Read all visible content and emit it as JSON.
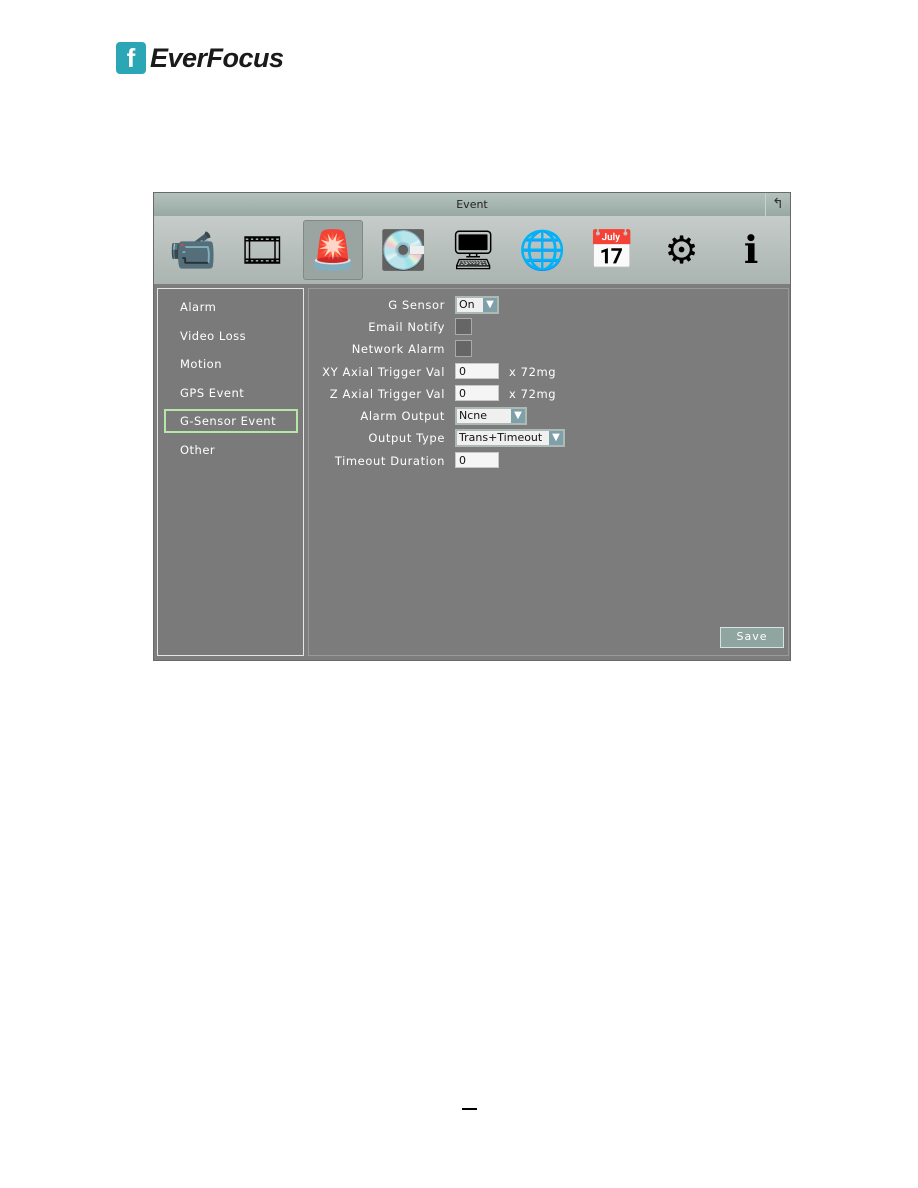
{
  "brand": {
    "logo_text": "EverFocus"
  },
  "window": {
    "title": "Event",
    "back_icon": "undo-arrow-icon"
  },
  "toolbar": {
    "icons": [
      "camera-icon",
      "film-reel-icon",
      "alarm-siren-icon",
      "hard-disk-icon",
      "monitor-icon",
      "network-globe-icon",
      "clock-calendar-icon",
      "gear-icon",
      "info-icon"
    ],
    "selected": "alarm-siren-icon"
  },
  "sidebar": {
    "items": [
      {
        "label": "Alarm"
      },
      {
        "label": "Video Loss"
      },
      {
        "label": "Motion"
      },
      {
        "label": "GPS Event"
      },
      {
        "label": "G-Sensor Event"
      },
      {
        "label": "Other"
      }
    ],
    "selected": "G-Sensor Event"
  },
  "form": {
    "g_sensor": {
      "label": "G Sensor",
      "value": "On"
    },
    "email_notify": {
      "label": "Email Notify",
      "checked": false
    },
    "network_alarm": {
      "label": "Network Alarm",
      "checked": false
    },
    "xy_trigger": {
      "label": "XY Axial Trigger Val",
      "value": "0",
      "unit": "x 72mg"
    },
    "z_trigger": {
      "label": "Z Axial Trigger Val",
      "value": "0",
      "unit": "x 72mg"
    },
    "alarm_output": {
      "label": "Alarm Output",
      "value": "Ncne"
    },
    "output_type": {
      "label": "Output Type",
      "value": "Trans+Timeout"
    },
    "timeout_duration": {
      "label": "Timeout Duration",
      "value": "0"
    }
  },
  "save_label": "Save",
  "colors": {
    "accent": "#2aa6b4",
    "selection": "#b7e7a8"
  }
}
